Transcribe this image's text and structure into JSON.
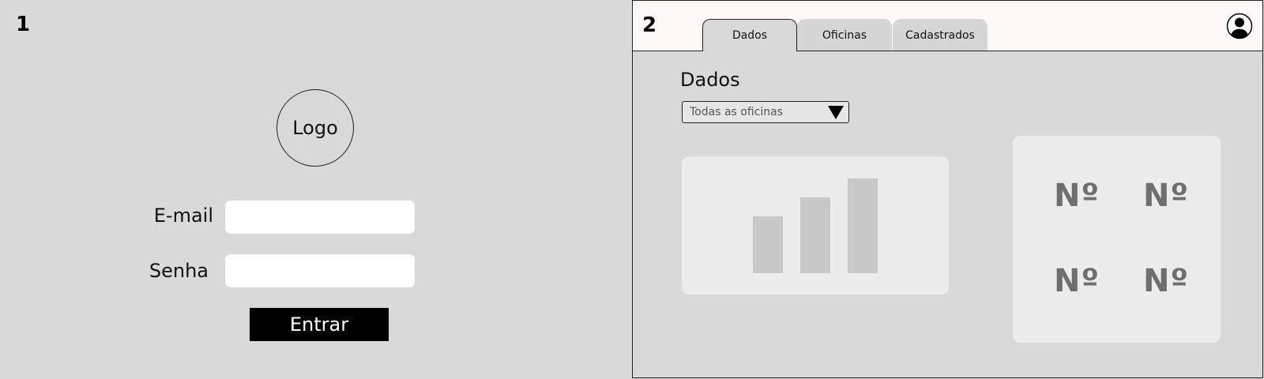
{
  "screen1": {
    "number": "1",
    "logo_text": "Logo",
    "email_label": "E-mail",
    "email_value": "",
    "password_label": "Senha",
    "password_value": "",
    "enter_label": "Entrar"
  },
  "screen2": {
    "number": "2",
    "tabs": [
      {
        "label": "Dados",
        "active": true
      },
      {
        "label": "Oficinas",
        "active": false
      },
      {
        "label": "Cadastrados",
        "active": false
      }
    ],
    "profile_icon": "user-avatar-icon",
    "section_title": "Dados",
    "filter_selected": "Todas as oficinas",
    "filter_icon": "triangle-down-icon",
    "chart": {
      "type": "bar",
      "values": [
        3,
        4,
        5
      ],
      "bar_color": "#c8c8c8"
    },
    "stats": [
      "Nº",
      "Nº",
      "Nº",
      "Nº"
    ]
  },
  "colors": {
    "background": "#d9d9d9",
    "card": "#ececec",
    "topbar": "#fff8f8",
    "button": "#000000",
    "stat_text": "#6f6f6f"
  }
}
